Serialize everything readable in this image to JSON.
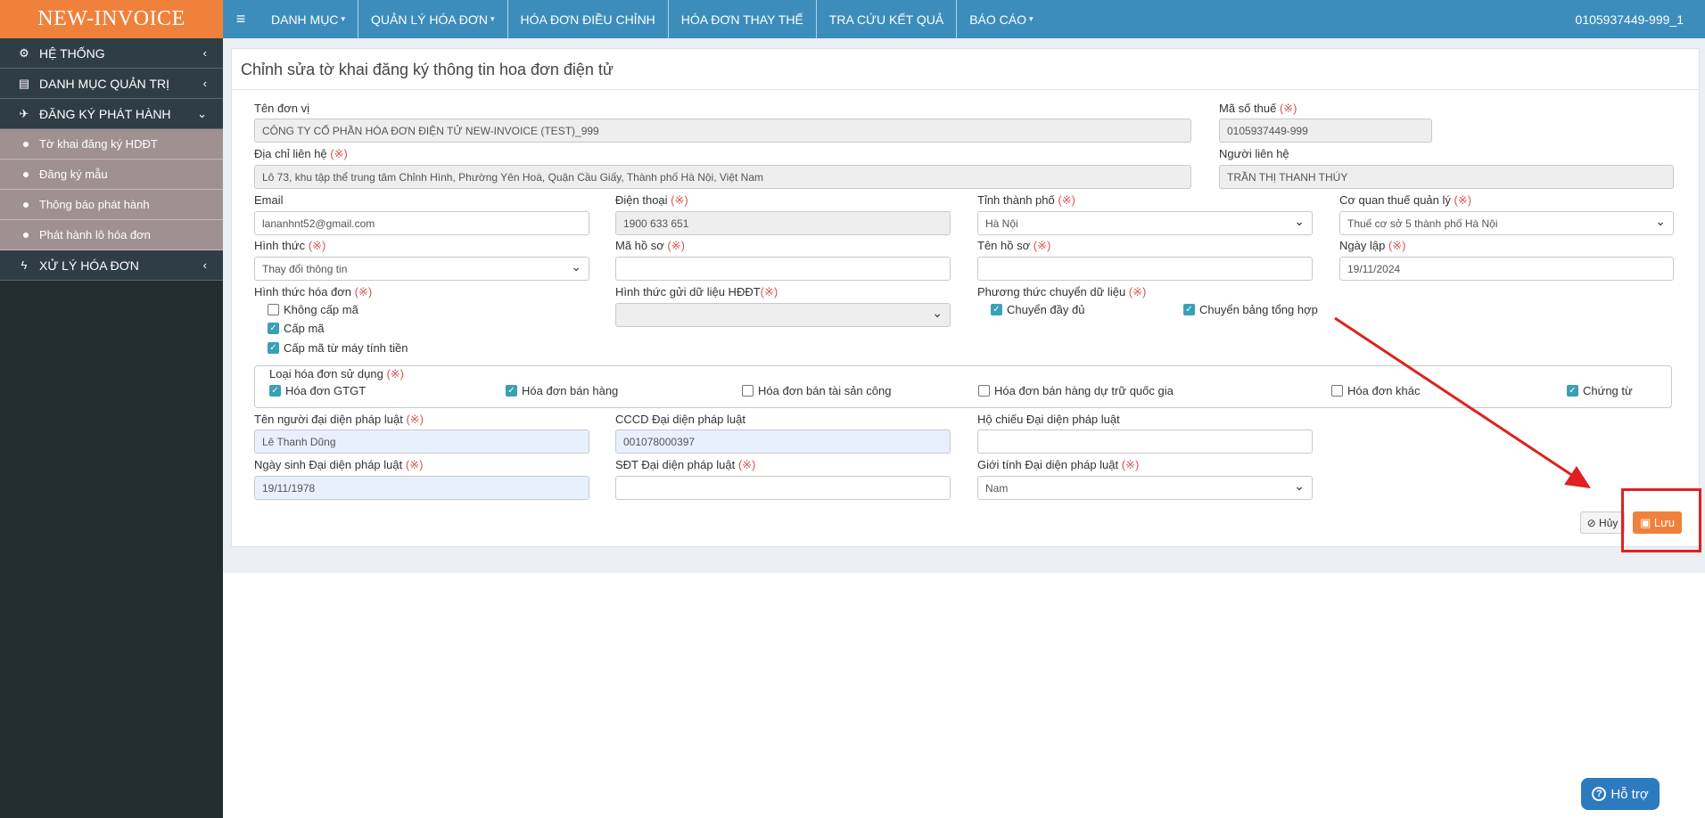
{
  "brand": "NEW-INVOICE",
  "nav": [
    {
      "label": "DANH MỤC",
      "caret": true
    },
    {
      "label": "QUẢN LÝ HÓA ĐƠN",
      "caret": true
    },
    {
      "label": "HÓA ĐƠN ĐIỀU CHỈNH",
      "caret": false
    },
    {
      "label": "HÓA ĐƠN THAY THẾ",
      "caret": false
    },
    {
      "label": "TRA CỨU KẾT QUẢ",
      "caret": false
    },
    {
      "label": "BÁO CÁO",
      "caret": true
    }
  ],
  "user": "0105937449-999_1",
  "sidebar": {
    "items": [
      {
        "label": "HỆ THỐNG",
        "icon": "gears-icon"
      },
      {
        "label": "DANH MỤC QUẢN TRỊ",
        "icon": "file-icon"
      },
      {
        "label": "ĐĂNG KÝ PHÁT HÀNH",
        "icon": "plane-icon"
      },
      {
        "label": "XỬ LÝ HÓA ĐƠN",
        "icon": "bolt-icon"
      }
    ],
    "subitems": [
      "Tờ khai đăng ký HDĐT",
      "Đăng ký mẫu",
      "Thông báo phát hành",
      "Phát hành lô hóa đơn"
    ]
  },
  "form": {
    "title": "Chỉnh sửa tờ khai đăng ký thông tin hoa đơn điện tử",
    "req_mark": "(※)",
    "ten_don_vi_label": "Tên đơn vị",
    "ten_don_vi": "CÔNG TY CỔ PHẦN HÓA ĐƠN ĐIỆN TỬ NEW-INVOICE (TEST)_999",
    "mst_label": "Mã số thuế",
    "mst": "0105937449-999",
    "dia_chi_label": "Địa chỉ liên hệ",
    "dia_chi": "Lô 73, khu tập thể trung tâm Chỉnh Hình, Phường Yên Hoà, Quận Cầu Giấy, Thành phố Hà Nội, Việt Nam",
    "nguoi_lien_he_label": "Người liên hệ",
    "nguoi_lien_he": "TRẦN THỊ THANH THÚY",
    "email_label": "Email",
    "email": "lananhnt52@gmail.com",
    "dien_thoai_label": "Điện thoại",
    "dien_thoai": "1900 633 651",
    "tinh_label": "Tỉnh thành phố",
    "tinh": "Hà Nội",
    "co_quan_thue_label": "Cơ quan thuế quản lý",
    "co_quan_thue": "Thuế cơ sở 5 thành phố Hà Nội",
    "hinh_thuc_label": "Hình thức",
    "hinh_thuc": "Thay đổi thông tin",
    "ma_ho_so_label": "Mã hồ sơ",
    "ma_ho_so": "",
    "ten_ho_so_label": "Tên hồ sơ",
    "ten_ho_so": "",
    "ngay_lap_label": "Ngày lập",
    "ngay_lap": "19/11/2024",
    "hinh_thuc_hd_label": "Hình thức hóa đơn",
    "hinh_thuc_hd": [
      {
        "label": "Không cấp mã",
        "checked": false
      },
      {
        "label": "Cấp mã",
        "checked": true
      },
      {
        "label": "Cấp mã từ máy tính tiền",
        "checked": true
      }
    ],
    "hinh_thuc_gui_label": "Hình thức gửi dữ liệu HĐĐT",
    "phuong_thuc_label": "Phương thức chuyển dữ liệu",
    "phuong_thuc": [
      {
        "label": "Chuyển đầy đủ",
        "checked": true
      },
      {
        "label": "Chuyển bảng tổng hợp",
        "checked": true
      }
    ],
    "loai_hd_label": "Loại hóa đơn sử dụng",
    "loai_hd": [
      {
        "label": "Hóa đơn GTGT",
        "checked": true
      },
      {
        "label": "Hóa đơn bán hàng",
        "checked": true
      },
      {
        "label": "Hóa đơn bán tài sản công",
        "checked": false
      },
      {
        "label": "Hóa đơn bán hàng dự trữ quốc gia",
        "checked": false
      },
      {
        "label": "Hóa đơn khác",
        "checked": false
      },
      {
        "label": "Chứng từ",
        "checked": true
      }
    ],
    "dai_dien_label": "Tên người đại diện pháp luật",
    "dai_dien": "Lê Thanh Dũng",
    "cccd_label": "CCCD Đại diện pháp luật",
    "cccd": "001078000397",
    "ho_chieu_label": "Hộ chiếu Đại diện pháp luật",
    "ho_chieu": "",
    "ngay_sinh_label": "Ngày sinh Đại diện pháp luật",
    "ngay_sinh": "19/11/1978",
    "sdt_label": "SĐT Đại diện pháp luật",
    "sdt": "",
    "gioi_tinh_label": "Giới tính Đại diện pháp luật",
    "gioi_tinh": "Nam"
  },
  "buttons": {
    "cancel": "Hủy",
    "save": "Lưu"
  },
  "help": "Hỗ trợ",
  "colors": {
    "brand": "#f0813c",
    "topbar": "#3c8dbc",
    "sidebar": "#222d32",
    "annotation": "#e02020"
  }
}
